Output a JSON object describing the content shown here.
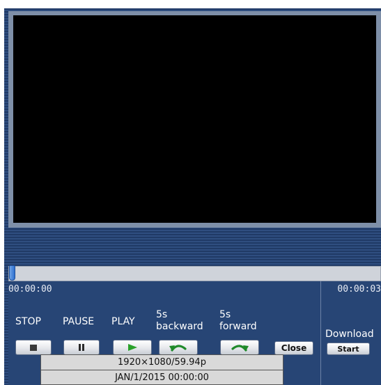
{
  "player": {
    "time_current": "00:00:00",
    "time_total": "00:00:03",
    "progress": 0
  },
  "controls": {
    "stop_label": "STOP",
    "pause_label": "PAUSE",
    "play_label": "PLAY",
    "backward_label_line1": "5s",
    "backward_label_line2": "backward",
    "forward_label_line1": "5s",
    "forward_label_line2": "forward",
    "close_button": "Close",
    "download_label": "Download",
    "start_button": "Start",
    "icons": {
      "stop": "stop-icon",
      "pause": "pause-icon",
      "play": "play-icon",
      "backward": "rewind-5s-icon",
      "forward": "forward-5s-icon"
    },
    "play_color": "#2aa12a",
    "rewind_color": "#1f8a2a"
  },
  "info": {
    "resolution": "1920×1080/59.94p",
    "datetime": "JAN/1/2015 00:00:00"
  }
}
